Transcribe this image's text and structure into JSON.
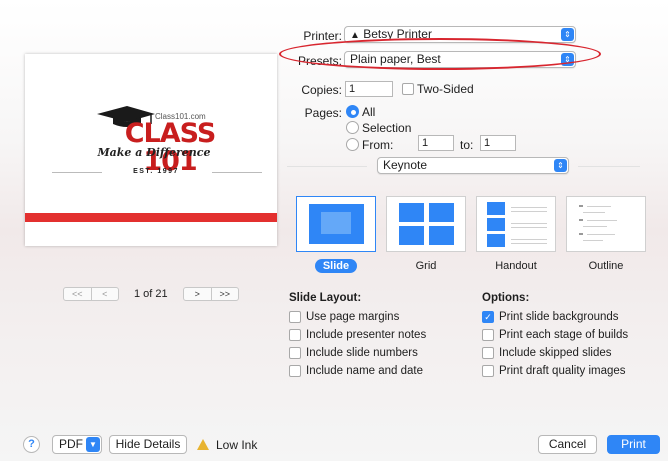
{
  "preview": {
    "logo_site": "Class101.com",
    "logo_name": "CLASS 101",
    "logo_slogan": "Make a Difference",
    "logo_est": "EST. 1997",
    "page_count": "1 of 21",
    "pager_first": "<<",
    "pager_prev": "<",
    "pager_next": ">",
    "pager_last": ">>"
  },
  "form": {
    "printer_label": "Printer:",
    "printer_value": "Betsy Printer",
    "presets_label": "Presets:",
    "presets_value": "Plain paper, Best",
    "copies_label": "Copies:",
    "copies_value": "1",
    "two_sided_label": "Two-Sided",
    "pages_label": "Pages:",
    "pages_all": "All",
    "pages_selection": "Selection",
    "pages_from": "From:",
    "from_value": "1",
    "to_label": "to:",
    "to_value": "1",
    "app_popup": "Keynote"
  },
  "layouts": {
    "slide": "Slide",
    "grid": "Grid",
    "handout": "Handout",
    "outline": "Outline"
  },
  "slide_layout": {
    "title": "Slide Layout:",
    "items": [
      "Use page margins",
      "Include presenter notes",
      "Include slide numbers",
      "Include name and date"
    ]
  },
  "options": {
    "title": "Options:",
    "items": [
      "Print slide backgrounds",
      "Print each stage of builds",
      "Include skipped slides",
      "Print draft quality images"
    ],
    "checked": [
      true,
      false,
      false,
      false
    ]
  },
  "footer": {
    "help": "?",
    "pdf": "PDF",
    "hide_details": "Hide Details",
    "low_ink": "Low Ink",
    "cancel": "Cancel",
    "print": "Print"
  },
  "colors": {
    "accent": "#2f86f6",
    "annotation": "#d8262f",
    "brand_red": "#e3302f"
  }
}
